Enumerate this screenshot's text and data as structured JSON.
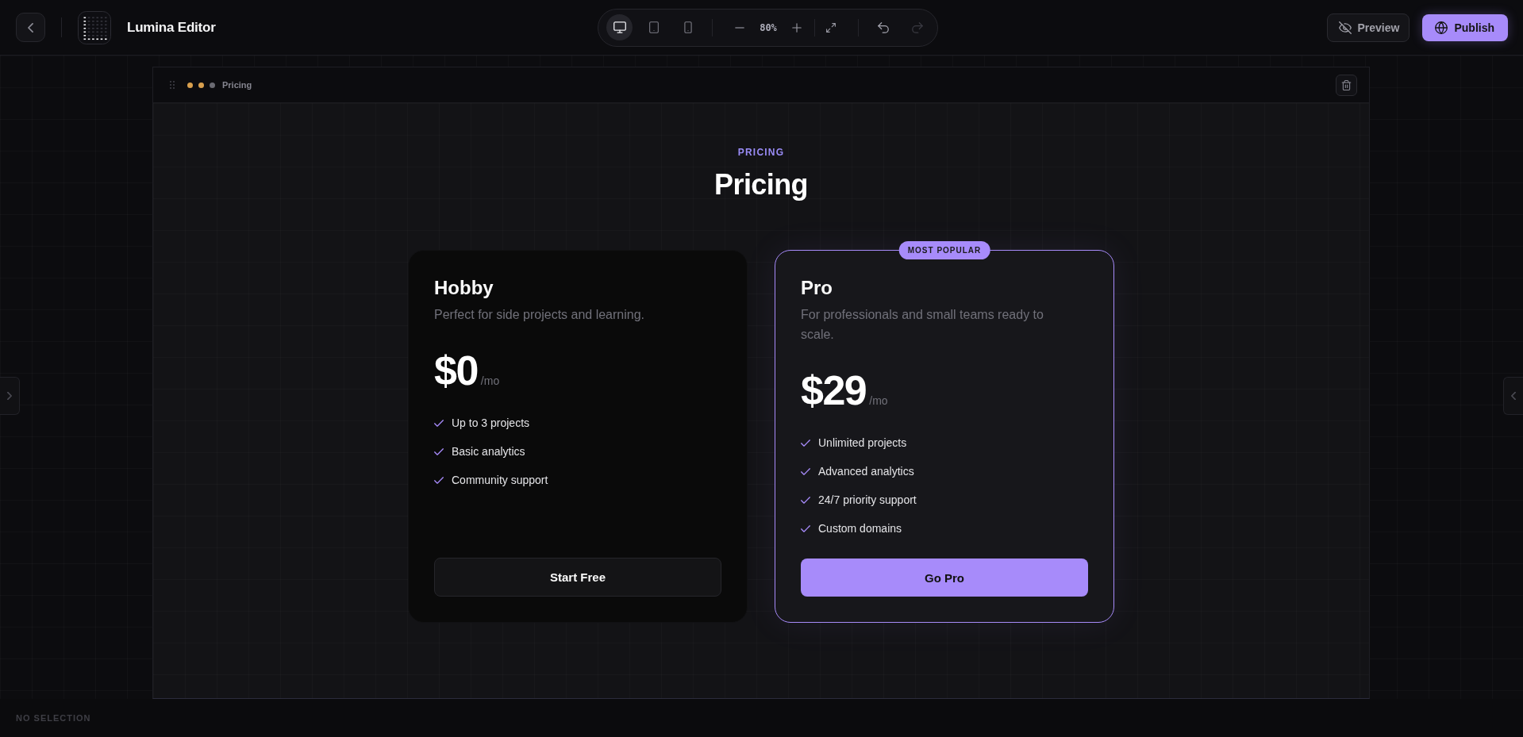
{
  "topbar": {
    "title": "Lumina Editor",
    "devices": [
      {
        "kind": "desktop",
        "selected": true
      },
      {
        "kind": "tablet",
        "selected": false
      },
      {
        "kind": "phone",
        "selected": false
      }
    ],
    "zoom": "80%",
    "history": [
      {
        "kind": "undo",
        "disabled": false
      },
      {
        "kind": "redo",
        "disabled": true
      }
    ],
    "actions": [
      {
        "kind": "secondary",
        "label": "Preview"
      },
      {
        "kind": "primary",
        "label": "Publish"
      }
    ]
  },
  "block": {
    "label": "Pricing",
    "dots": [
      {
        "color": "#d9a04e"
      },
      {
        "color": "#d9a04e"
      },
      {
        "color": "#6b6b73"
      }
    ]
  },
  "pricing": {
    "eyebrow": "PRICING",
    "heading": "Pricing",
    "plans": [
      {
        "name": "Hobby",
        "description": "Perfect for side projects and learning.",
        "price": "$0",
        "period": "/mo",
        "features": [
          "Up to 3 projects",
          "Basic analytics",
          "Community support"
        ],
        "cta": "Start Free",
        "featured": false
      },
      {
        "name": "Pro",
        "description": "For professionals and small teams ready to scale.",
        "price": "$29",
        "period": "/mo",
        "features": [
          "Unlimited projects",
          "Advanced analytics",
          "24/7 priority support",
          "Custom domains"
        ],
        "cta": "Go Pro",
        "featured": true,
        "badge": "MOST POPULAR"
      }
    ]
  },
  "status_bar": {
    "text": "NO SELECTION"
  }
}
